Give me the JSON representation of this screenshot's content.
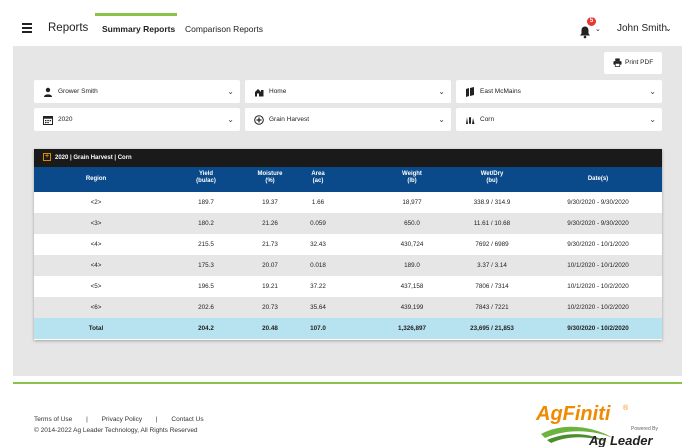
{
  "header": {
    "brand": "Reports",
    "tabs": [
      {
        "label": "Summary Reports",
        "active": true
      },
      {
        "label": "Comparison Reports",
        "active": false
      }
    ],
    "notification_count": "5",
    "user_name": "John Smith"
  },
  "toolbar": {
    "print_label": "Print PDF"
  },
  "filters": {
    "grower": "Grower Smith",
    "farm": "Home",
    "field": "East McMains",
    "year": "2020",
    "operation": "Grain Harvest",
    "crop": "Corn"
  },
  "table": {
    "title": "2020 | Grain Harvest | Corn",
    "columns": [
      {
        "line1": "Region",
        "line2": ""
      },
      {
        "line1": "Yield",
        "line2": "(bu/ac)"
      },
      {
        "line1": "Moisture",
        "line2": "(%)"
      },
      {
        "line1": "Area",
        "line2": "(ac)"
      },
      {
        "line1": "Weight",
        "line2": "(lb)"
      },
      {
        "line1": "Wet/Dry",
        "line2": "(bu)"
      },
      {
        "line1": "Date(s)",
        "line2": ""
      }
    ],
    "rows": [
      [
        "<2>",
        "189.7",
        "19.37",
        "1.66",
        "18,977",
        "338.9 / 314.9",
        "9/30/2020 - 9/30/2020"
      ],
      [
        "<3>",
        "180.2",
        "21.26",
        "0.059",
        "650.0",
        "11.61 / 10.68",
        "9/30/2020 - 9/30/2020"
      ],
      [
        "<4>",
        "215.5",
        "21.73",
        "32.43",
        "430,724",
        "7692 / 6989",
        "9/30/2020 - 10/1/2020"
      ],
      [
        "<4>",
        "175.3",
        "20.07",
        "0.018",
        "189.0",
        "3.37 / 3.14",
        "10/1/2020 - 10/1/2020"
      ],
      [
        "<5>",
        "196.5",
        "19.21",
        "37.22",
        "437,158",
        "7806 / 7314",
        "10/1/2020 - 10/2/2020"
      ],
      [
        "<6>",
        "202.6",
        "20.73",
        "35.64",
        "439,199",
        "7843 / 7221",
        "10/2/2020 - 10/2/2020"
      ]
    ],
    "total": [
      "Total",
      "204.2",
      "20.48",
      "107.0",
      "1,326,897",
      "23,695 / 21,853",
      "9/30/2020 - 10/2/2020"
    ]
  },
  "footer": {
    "links": [
      "Terms of Use",
      "|",
      "Privacy Policy",
      "|",
      "Contact Us"
    ],
    "copyright": "© 2014-2022 Ag Leader Technology, All Rights Reserved",
    "logo_main": "AgFiniti",
    "logo_reg": "®",
    "logo_powered": "Powered By",
    "logo_sub": "Ag Leader"
  },
  "colors": {
    "accent_green": "#8bc34a",
    "table_header_blue": "#0a4a8a",
    "total_row": "#b7e3f0",
    "badge_red": "#e53935",
    "logo_orange": "#f08a00"
  }
}
